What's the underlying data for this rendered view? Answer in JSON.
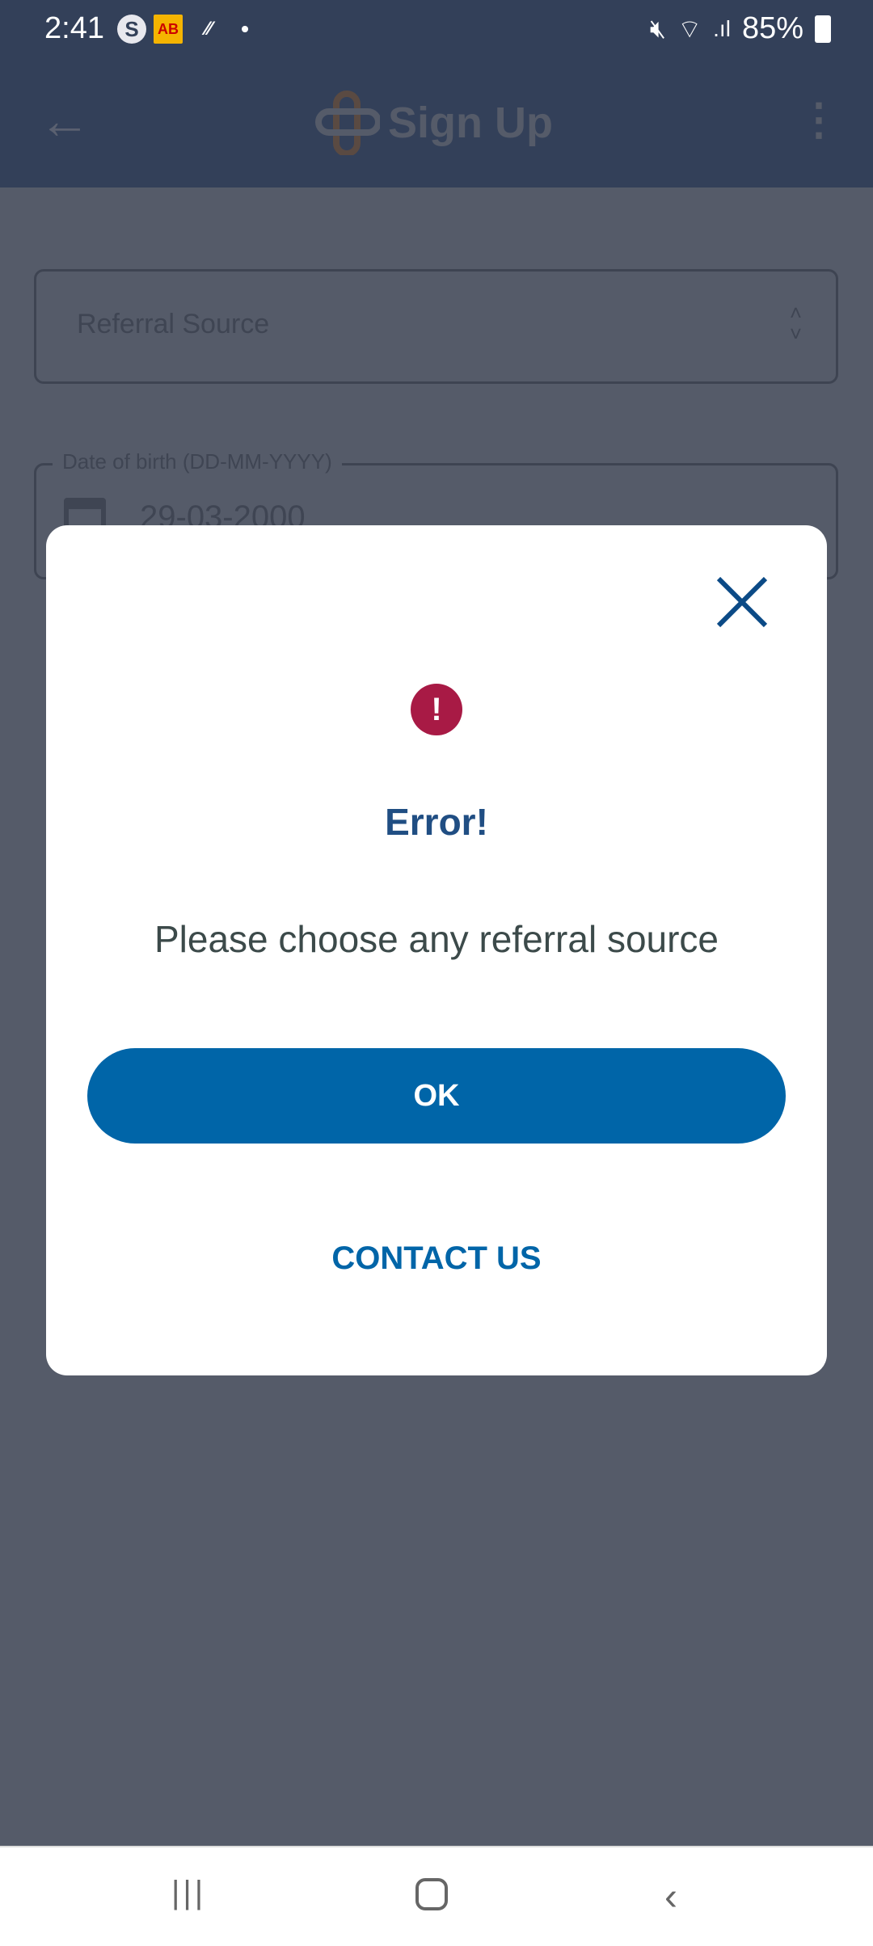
{
  "status_bar": {
    "time": "2:41",
    "battery": "85%"
  },
  "app_bar": {
    "title": "Sign Up"
  },
  "form": {
    "referral_placeholder": "Referral Source",
    "dob_label": "Date of birth (DD-MM-YYYY)",
    "dob_value": "29-03-2000"
  },
  "dialog": {
    "title": "Error!",
    "message": "Please choose any referral source",
    "ok_label": "OK",
    "contact_label": "CONTACT US",
    "icon_mark": "!"
  },
  "colors": {
    "accent": "#0065a8",
    "error": "#a81a45",
    "header": "#334059"
  }
}
